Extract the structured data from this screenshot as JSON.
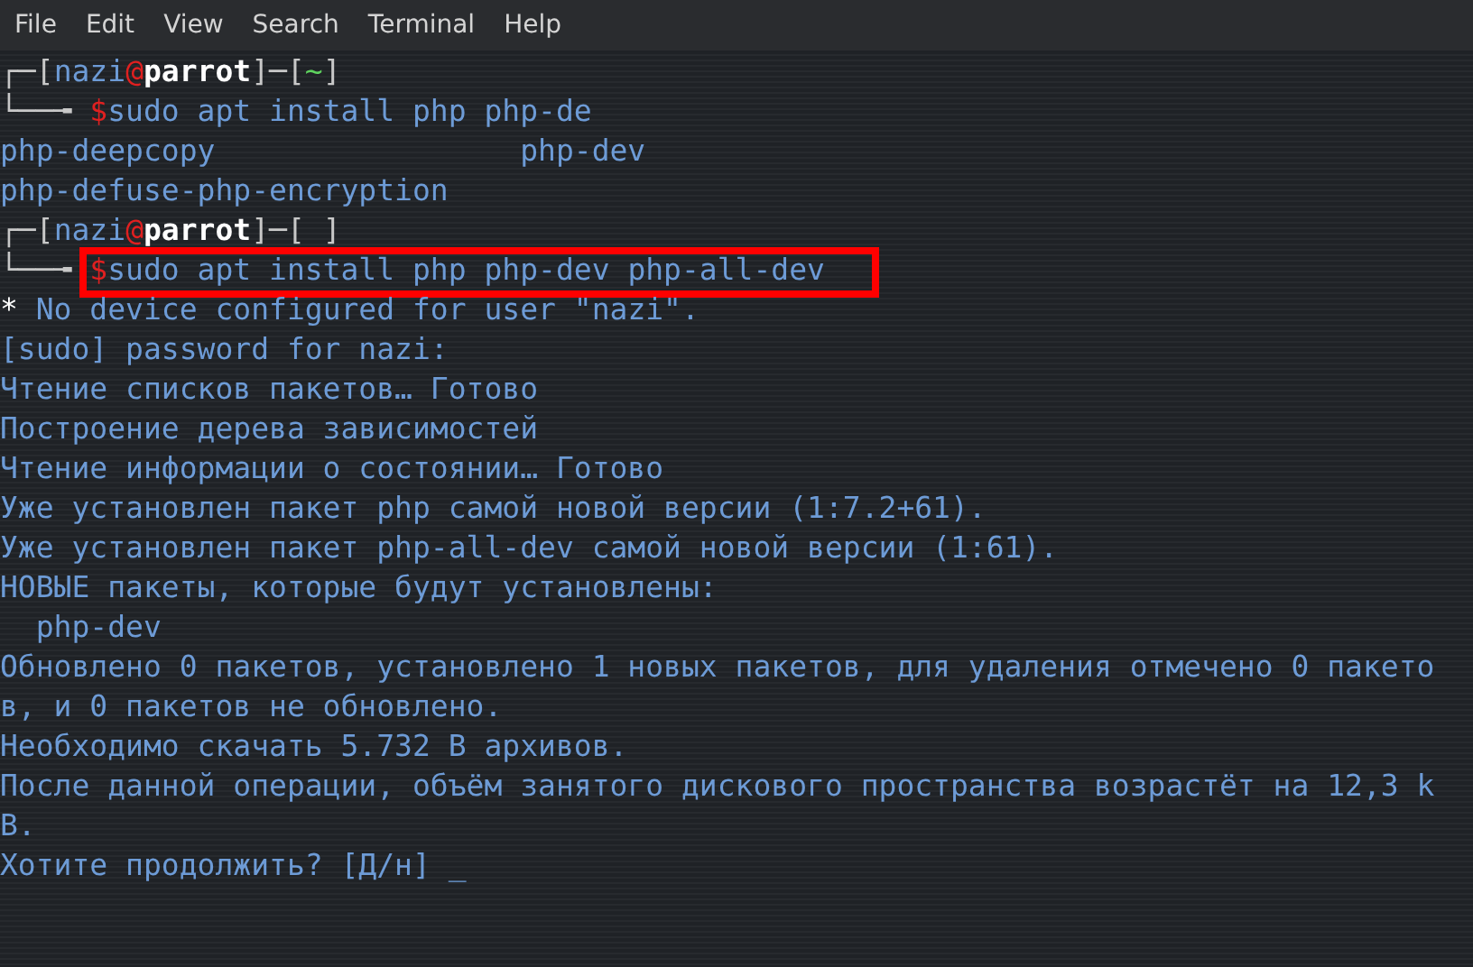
{
  "menu": [
    "File",
    "Edit",
    "View",
    "Search",
    "Terminal",
    "Help"
  ],
  "lines": [
    {
      "segments": [
        {
          "kind": "frame",
          "text": "┌─["
        },
        {
          "kind": "user",
          "text": "nazi"
        },
        {
          "kind": "at",
          "text": "@"
        },
        {
          "kind": "host",
          "text": "parrot"
        },
        {
          "kind": "frame",
          "text": "]─["
        },
        {
          "kind": "dir",
          "text": "~"
        },
        {
          "kind": "frame",
          "text": "]"
        }
      ]
    },
    {
      "segments": [
        {
          "kind": "frame",
          "text": "└──╼ "
        },
        {
          "kind": "dollar",
          "text": "$"
        },
        {
          "kind": "command",
          "text": "sudo apt install php php-de"
        }
      ]
    },
    {
      "segments": [
        {
          "kind": "output",
          "text": "php-deepcopy                 php-dev"
        }
      ]
    },
    {
      "segments": [
        {
          "kind": "output",
          "text": "php-defuse-php-encryption"
        }
      ]
    },
    {
      "segments": [
        {
          "kind": "frame",
          "text": "┌─["
        },
        {
          "kind": "user",
          "text": "nazi"
        },
        {
          "kind": "at",
          "text": "@"
        },
        {
          "kind": "host",
          "text": "parrot"
        },
        {
          "kind": "frame",
          "text": "]─[ ]"
        }
      ]
    },
    {
      "highlighted": true,
      "segments": [
        {
          "kind": "frame",
          "text": "└──╼ "
        },
        {
          "kind": "dollar",
          "text": "$"
        },
        {
          "kind": "command",
          "text": "sudo apt install php php-dev php-all-dev"
        }
      ]
    },
    {
      "segments": [
        {
          "kind": "star",
          "text": "*"
        },
        {
          "kind": "output",
          "text": " No device configured for user \"nazi\"."
        }
      ]
    },
    {
      "segments": [
        {
          "kind": "output",
          "text": "[sudo] password for nazi:"
        }
      ]
    },
    {
      "segments": [
        {
          "kind": "output",
          "text": "Чтение списков пакетов… Готово"
        }
      ]
    },
    {
      "segments": [
        {
          "kind": "output",
          "text": "Построение дерева зависимостей"
        }
      ]
    },
    {
      "segments": [
        {
          "kind": "output",
          "text": "Чтение информации о состоянии… Готово"
        }
      ]
    },
    {
      "segments": [
        {
          "kind": "output",
          "text": "Уже установлен пакет php самой новой версии (1:7.2+61)."
        }
      ]
    },
    {
      "segments": [
        {
          "kind": "output",
          "text": "Уже установлен пакет php-all-dev самой новой версии (1:61)."
        }
      ]
    },
    {
      "segments": [
        {
          "kind": "output",
          "text": "НОВЫЕ пакеты, которые будут установлены:"
        }
      ]
    },
    {
      "segments": [
        {
          "kind": "output",
          "text": "  php-dev"
        }
      ]
    },
    {
      "segments": [
        {
          "kind": "output",
          "text": "Обновлено 0 пакетов, установлено 1 новых пакетов, для удаления отмечено 0 пакето"
        }
      ]
    },
    {
      "segments": [
        {
          "kind": "output",
          "text": "в, и 0 пакетов не обновлено."
        }
      ]
    },
    {
      "segments": [
        {
          "kind": "output",
          "text": "Необходимо скачать 5.732 B архивов."
        }
      ]
    },
    {
      "segments": [
        {
          "kind": "output",
          "text": "После данной операции, объём занятого дискового пространства возрастёт на 12,3 k"
        }
      ]
    },
    {
      "segments": [
        {
          "kind": "output",
          "text": "B."
        }
      ]
    },
    {
      "segments": [
        {
          "kind": "output",
          "text": "Хотите продолжить? [Д/н] _"
        }
      ]
    }
  ]
}
